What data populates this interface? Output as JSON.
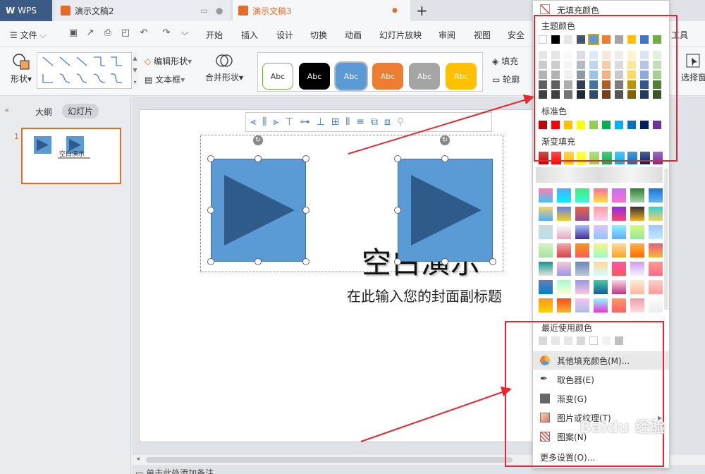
{
  "tabs": {
    "app": "WPS",
    "doc1": "演示文稿2",
    "doc2": "演示文稿3",
    "add": "+"
  },
  "menu": {
    "file": "文件",
    "items": [
      "开始",
      "插入",
      "设计",
      "切换",
      "动画",
      "幻灯片放映",
      "审阅",
      "视图",
      "安全"
    ],
    "tools_tail": "工具"
  },
  "ribbon": {
    "shape": "形状",
    "edit_shape": "编辑形状",
    "textbox": "文本框",
    "merge_shape": "合并形状",
    "style_label": "Abc",
    "fill": "填充",
    "outline": "轮廓",
    "select_pane": "选择窗"
  },
  "left_panel": {
    "outline_tab": "大纲",
    "slides_tab": "幻灯片",
    "slide_number": "1",
    "thumb_title": "空白演示"
  },
  "slide": {
    "title": "空白演示",
    "subtitle": "在此输入您的封面副标题"
  },
  "status": {
    "notes": "单击此处添加备注"
  },
  "fill_panel": {
    "no_fill": "无填充颜色",
    "theme_colors": "主题颜色",
    "standard_colors": "标准色",
    "gradient_fill": "渐变填充",
    "recent_colors": "最近使用颜色",
    "more_fill": "其他填充颜色(M)...",
    "eyedropper": "取色器(E)",
    "gradient": "渐变(G)",
    "picture_texture": "图片或纹理(T)",
    "pattern": "图案(N)",
    "more_settings": "更多设置(O)...",
    "theme_row": [
      "#ffffff",
      "#000000",
      "#e7e6e6",
      "#44546a",
      "#5b9bd5",
      "#ed7d31",
      "#a5a5a5",
      "#ffc000",
      "#4472c4",
      "#70ad47"
    ],
    "standard_row": [
      "#c00000",
      "#ff0000",
      "#ffc000",
      "#ffff00",
      "#92d050",
      "#00b050",
      "#00b0f0",
      "#0070c0",
      "#002060",
      "#7030a0"
    ],
    "gradient_row": [
      "#c00000",
      "#ff0000",
      "#ffc000",
      "#ffff00",
      "#92d050",
      "#00b050",
      "#00b0f0",
      "#0070c0",
      "#002060",
      "#7030a0"
    ]
  },
  "watermark": "Baidu 经验"
}
